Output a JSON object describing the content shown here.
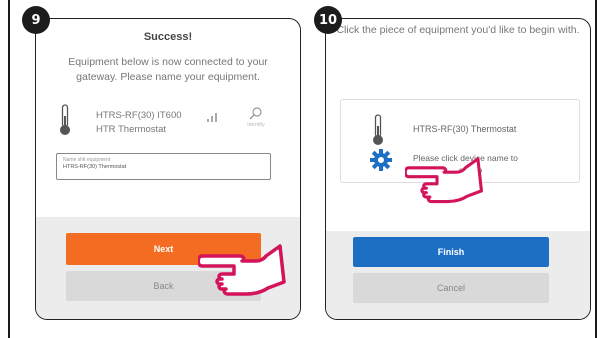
{
  "steps": [
    {
      "number": "9",
      "title": "Success!",
      "subtitle": "Equipment below is now connected to your gateway. Please name your equipment.",
      "device": {
        "name_line1": "HTRS-RF(30) IT600",
        "name_line2": "HTR Thermostat",
        "identify_label": "identify"
      },
      "name_field": {
        "label": "Name shit equipment",
        "value": "HTRS-RF(30) Thermostat"
      },
      "primary_button": "Next",
      "secondary_button": "Back"
    },
    {
      "number": "10",
      "subtitle": "Click the piece of equipment you'd like to begin with.",
      "device": {
        "name": "HTRS-RF(30) Thermostat",
        "hint_line1": "Please click device name to",
        "hint_line2": "set up"
      },
      "primary_button": "Finish",
      "secondary_button": "Cancel"
    }
  ],
  "colors": {
    "orange": "#f36c21",
    "blue": "#1d6fc4",
    "hand": "#d4145a",
    "gear": "#1d6fc4"
  }
}
